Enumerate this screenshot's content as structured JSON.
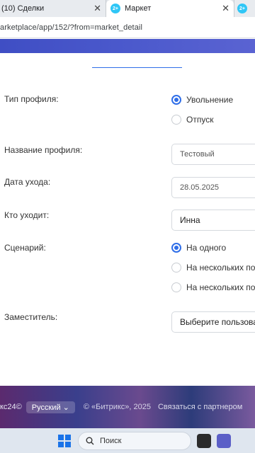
{
  "browser": {
    "tabs": [
      {
        "label": "(10) Сделки",
        "close": "✕"
      },
      {
        "label": "Маркет",
        "close": "✕",
        "favicon": "2+"
      },
      {
        "favicon": "2+"
      }
    ],
    "url": "arketplace/app/152/?from=market_detail"
  },
  "form": {
    "profile_type_label": "Тип профиля:",
    "profile_type_options": [
      "Увольнение",
      "Отпуск"
    ],
    "profile_name_label": "Название профиля:",
    "profile_name_value": "Тестовый",
    "leave_date_label": "Дата ухода:",
    "leave_date_value": "28.05.2025",
    "who_leaves_label": "Кто уходит:",
    "who_leaves_value": "Инна",
    "scenario_label": "Сценарий:",
    "scenario_options": [
      "На одного",
      "На нескольких по",
      "На нескольких по"
    ],
    "deputy_label": "Заместитель:",
    "deputy_placeholder": "Выберите пользова"
  },
  "footer": {
    "logo_text": "кс24©",
    "language": "Русский",
    "copyright": "© «Битрикс», 2025",
    "partner_link": "Связаться с партнером"
  },
  "taskbar": {
    "search_label": "Поиск"
  },
  "colors": {
    "accent": "#2f6ee8",
    "header_band": "#4b59cc",
    "taskbar": "#dfe6ef"
  }
}
